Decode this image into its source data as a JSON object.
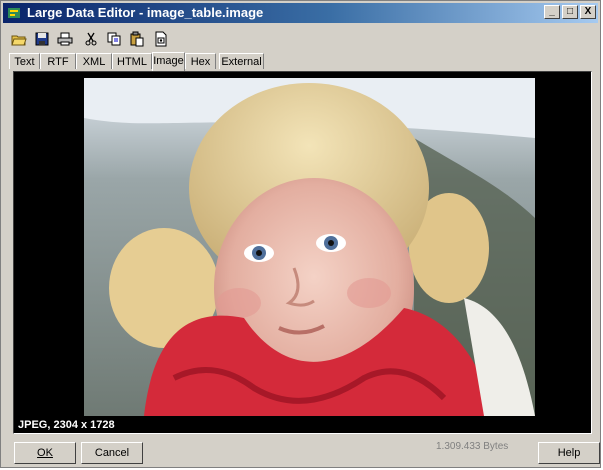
{
  "window": {
    "title": "Large Data Editor - image_table.image",
    "minimize": "_",
    "maximize": "□",
    "close": "X"
  },
  "toolbar": {
    "icons": [
      "open-icon",
      "save-icon",
      "print-icon",
      "cut-icon",
      "copy-icon",
      "paste-icon",
      "properties-icon"
    ]
  },
  "tabs": [
    {
      "label": "Text"
    },
    {
      "label": "RTF"
    },
    {
      "label": "XML"
    },
    {
      "label": "HTML"
    },
    {
      "label": "Image"
    },
    {
      "label": "Hex"
    },
    {
      "label": "External"
    }
  ],
  "active_tab": "Image",
  "viewer": {
    "caption": "JPEG, 2304 x 1728",
    "background": "#000000"
  },
  "footer": {
    "ok_label": "OK",
    "cancel_label": "Cancel",
    "bytes": "1.309.433 Bytes",
    "help_label": "Help"
  }
}
